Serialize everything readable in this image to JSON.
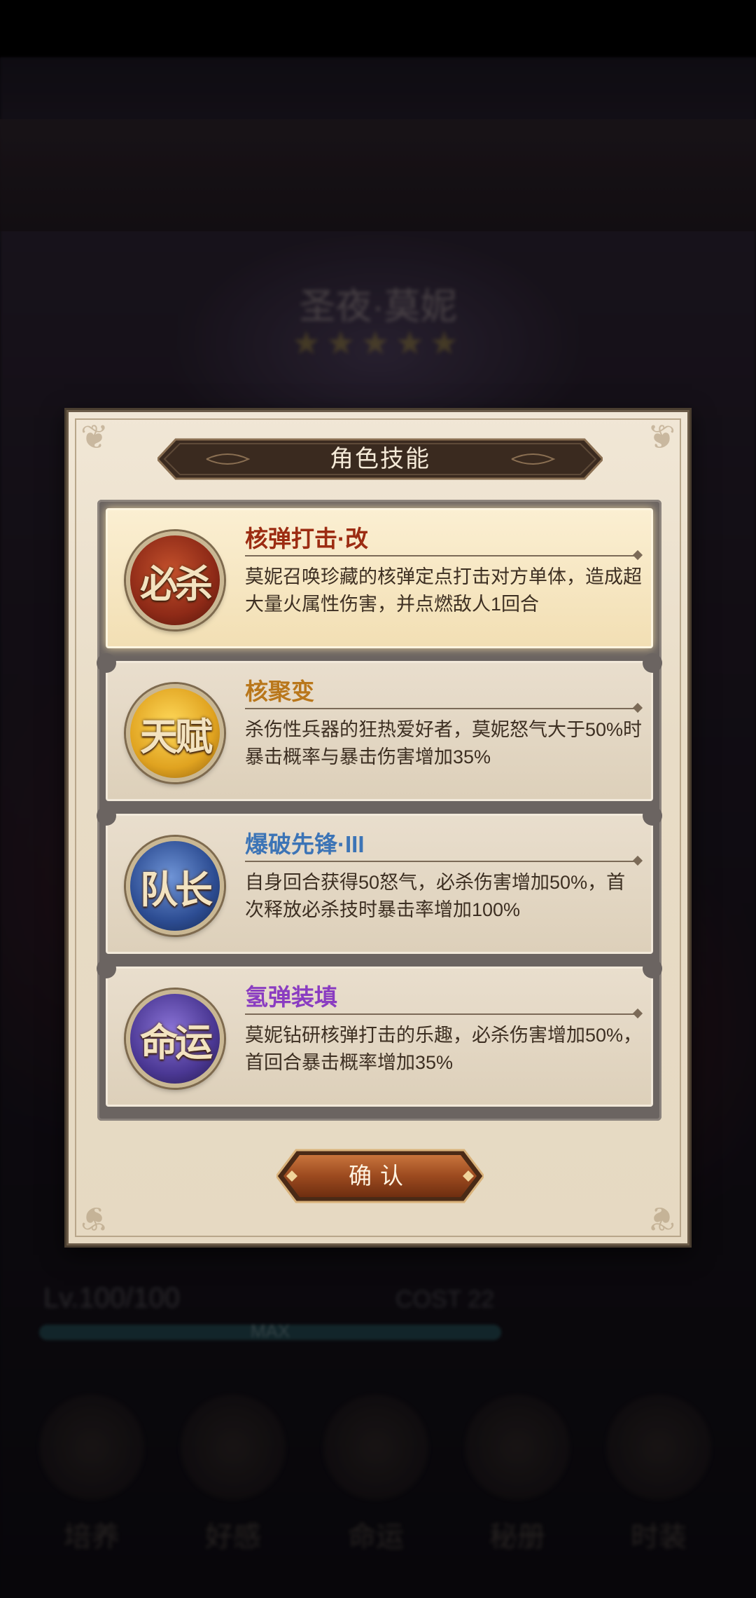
{
  "background": {
    "hero_name": "圣夜·莫妮",
    "stars": "★★★★★",
    "level_text": "Lv.100/100",
    "cost_text": "COST 22",
    "exp_bar_label": "MAX",
    "exp_progress": 1.0,
    "nav_buttons": [
      "培养",
      "好感",
      "命运",
      "秘册",
      "时装"
    ]
  },
  "dialog": {
    "title": "角色技能",
    "skills": [
      {
        "icon_text": "必杀",
        "icon_color": "#8e2a17",
        "name": "核弹打击·改",
        "name_color": "#9c2c12",
        "description": "莫妮召唤珍藏的核弹定点打击对方单体，造成超大量火属性伤害，并点燃敌人1回合",
        "selected": true
      },
      {
        "icon_text": "天赋",
        "icon_color": "#e0a320",
        "name": "核聚变",
        "name_color": "#b9771b",
        "description": "杀伤性兵器的狂热爱好者，莫妮怒气大于50%时暴击概率与暴击伤害增加35%",
        "selected": false
      },
      {
        "icon_text": "队长",
        "icon_color": "#2d4d93",
        "name": "爆破先锋·III",
        "name_color": "#3c74b6",
        "description": "自身回合获得50怒气，必杀伤害增加50%，首次释放必杀技时暴击率增加100%",
        "selected": false
      },
      {
        "icon_text": "命运",
        "icon_color": "#4b3894",
        "name": "氢弹装填",
        "name_color": "#8a3cc1",
        "description": "莫妮钻研核弹打击的乐趣，必杀伤害增加50%，首回合暴击概率增加35%",
        "selected": false
      }
    ],
    "confirm_label": "确认"
  }
}
